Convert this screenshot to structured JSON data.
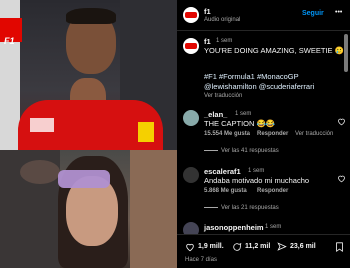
{
  "header": {
    "username": "f1",
    "subtitle": "Audio original",
    "follow_label": "Seguir",
    "more_label": "•••"
  },
  "caption": {
    "username": "f1",
    "time": "1 sem",
    "text": "YOU'RE DOING AMAZING, SWEETIE",
    "emoji": "🥲",
    "hashtags": "#F1 #Formula1 #MonacoGP",
    "mention_line_1": "@lewishamilton @scuderiaferrari",
    "translate": "Ver traducción"
  },
  "comments": [
    {
      "username": "_elan_",
      "time": "1 sem",
      "text": "THE CAPTION 😂😂",
      "likes": "15.554 Me gusta",
      "reply": "Responder",
      "translate": "Ver traducción",
      "replies": "Ver las 41 respuestas"
    },
    {
      "username": "escaleraf1",
      "time": "1 sem",
      "text": "Andaba motivado mi muchacho",
      "likes": "5.868 Me gusta",
      "reply": "Responder",
      "translate": "",
      "replies": "Ver las 21 respuestas"
    },
    {
      "username": "jasonoppenheim",
      "time": "1 sem",
      "text": "",
      "likes": "",
      "reply": "",
      "translate": "",
      "replies": ""
    }
  ],
  "footer": {
    "likes": "1,9 mill.",
    "comments": "11,2 mil",
    "shares": "23,6 mil",
    "date": "Hace 7 días"
  },
  "colors": {
    "accent": "#e10600",
    "link": "#e0f1ff",
    "follow": "#0095f6"
  }
}
